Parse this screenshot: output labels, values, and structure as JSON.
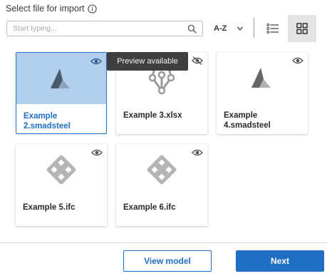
{
  "header": {
    "title": "Select file for import",
    "info_icon": "info-icon"
  },
  "search": {
    "placeholder": "Start typing...",
    "value": "",
    "icon": "search-icon"
  },
  "sort": {
    "label": "A-Z",
    "icon": "chevron-down-icon"
  },
  "view_toggle": {
    "list_icon": "list-view-icon",
    "grid_icon": "grid-view-icon",
    "active": "grid"
  },
  "files": [
    {
      "name": "Example 2.smadsteel",
      "type": "smadsteel",
      "selected": true,
      "preview_available": true
    },
    {
      "name": "Example 3.xlsx",
      "type": "xlsx",
      "selected": false,
      "preview_available": false
    },
    {
      "name": "Example 4.smadsteel",
      "type": "smadsteel",
      "selected": false,
      "preview_available": true
    },
    {
      "name": "Example 5.ifc",
      "type": "ifc",
      "selected": false,
      "preview_available": true
    },
    {
      "name": "Example 6.ifc",
      "type": "ifc",
      "selected": false,
      "preview_available": true
    }
  ],
  "tooltip": {
    "text": "Preview available"
  },
  "footer": {
    "view_model_label": "View model",
    "next_label": "Next"
  },
  "colors": {
    "accent": "#1f6fc4",
    "selected_thumb": "#b3cfee",
    "tooltip_bg": "#3f3f3f"
  }
}
